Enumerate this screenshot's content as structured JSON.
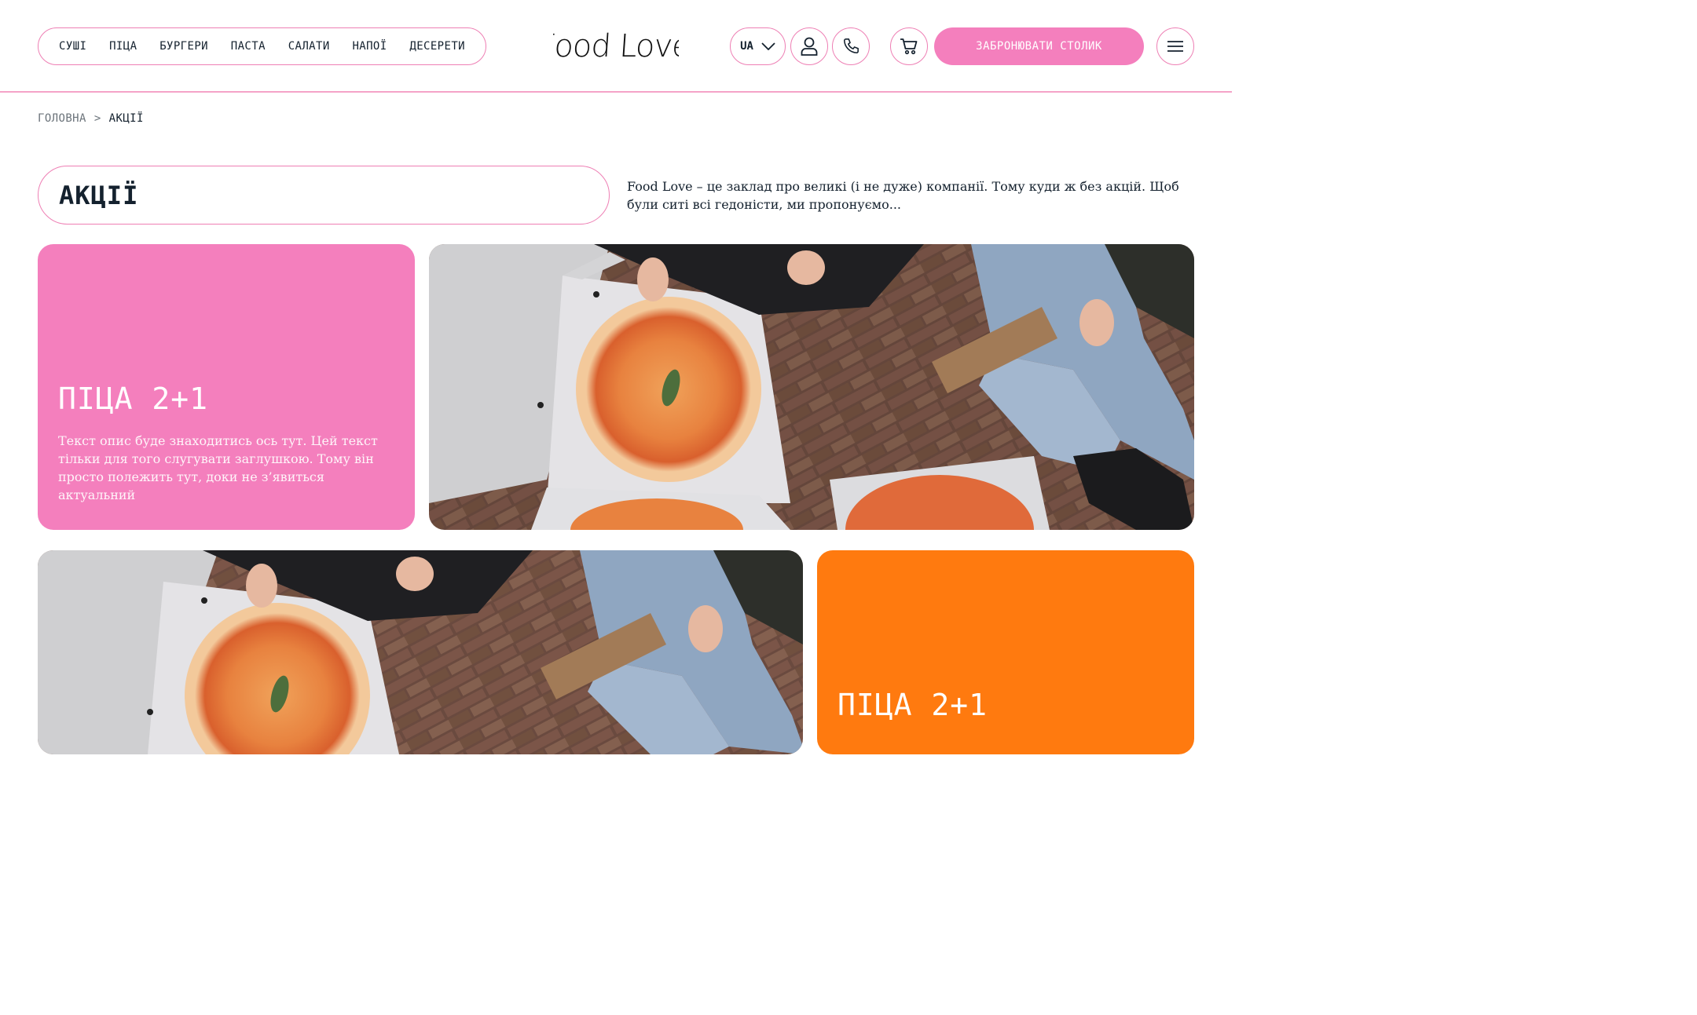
{
  "nav": {
    "items": [
      {
        "label": "СУШІ"
      },
      {
        "label": "ПІЦА"
      },
      {
        "label": "БУРГЕРИ"
      },
      {
        "label": "ПАСТА"
      },
      {
        "label": "САЛАТИ"
      },
      {
        "label": "НАПОЇ"
      },
      {
        "label": "ДЕСЕРЕТИ"
      }
    ]
  },
  "brand": {
    "logo": "Food Love"
  },
  "header": {
    "language": "UA",
    "book_label": "ЗАБРОНЮВАТИ СТОЛИК",
    "icons": [
      "chevron-down-icon",
      "user-icon",
      "phone-icon",
      "cart-icon",
      "menu-icon"
    ]
  },
  "breadcrumb": {
    "home": "ГОЛОВНА",
    "separator": ">",
    "current": "АКЦІЇ"
  },
  "page": {
    "title": "АКЦІЇ",
    "intro": "Food Love – це заклад про великі (і не дуже) компанії. Тому куди ж без акцій. Щоб були ситі всі гедоністи, ми пропонуємо..."
  },
  "promos": [
    {
      "title": "ПІЦА 2+1",
      "description": "Текст опис буде знаходитись ось тут. Цей текст тільки для того слугувати заглушкою. Тому він просто полежить тут, доки не з’явиться актуальний",
      "color": "#f47fbd"
    },
    {
      "title": "ПІЦА 2+1",
      "color": "#ff7a0f"
    }
  ],
  "colors": {
    "accent_pink": "#f47fbd",
    "border_pink": "#ee7fb4",
    "accent_orange": "#ff7a0f",
    "text_dark": "#14212e"
  }
}
